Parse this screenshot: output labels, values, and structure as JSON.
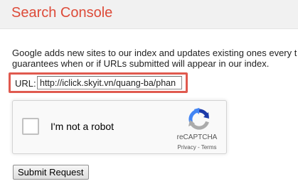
{
  "app": {
    "title": "Search Console"
  },
  "description": {
    "line1": "Google adds new sites to our index and updates existing ones every t",
    "line2": "guarantees when or if URLs submitted will appear in our index."
  },
  "url_field": {
    "label": "URL:",
    "value": "http://iclick.skyit.vn/quang-ba/phan",
    "highlight_color": "#e05a4f"
  },
  "recaptcha": {
    "checkbox_label": "I'm not a robot",
    "checked": false,
    "brand": "reCAPTCHA",
    "privacy_link": "Privacy",
    "separator": " - ",
    "terms_link": "Terms",
    "logo_icon": "recaptcha-logo-icon"
  },
  "actions": {
    "submit_label": "Submit Request"
  },
  "colors": {
    "title": "#dd4b39",
    "header_bg": "#f1f1f1"
  }
}
